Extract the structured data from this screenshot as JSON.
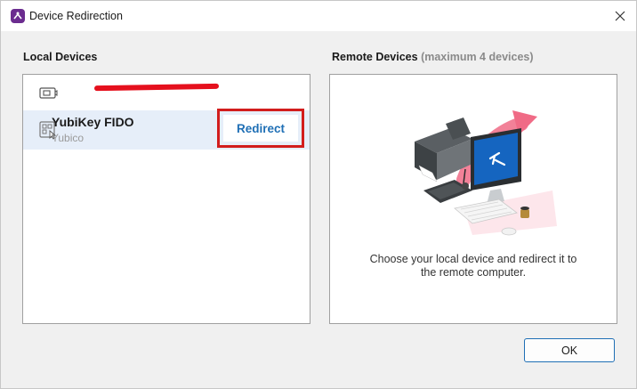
{
  "window": {
    "title": "Device Redirection",
    "close_symbol": "✕"
  },
  "local": {
    "heading": "Local Devices",
    "devices": [
      {
        "name": "",
        "vendor": "",
        "icon": "camera-icon",
        "redacted": true
      },
      {
        "name": "YubiKey FIDO",
        "vendor": "Yubico",
        "icon": "security-key-icon",
        "selected": true
      }
    ],
    "redirect_label": "Redirect"
  },
  "remote": {
    "heading": "Remote Devices",
    "heading_note": "(maximum 4 devices)",
    "empty_text_line1": "Choose your local device and redirect it to",
    "empty_text_line2": "the remote computer."
  },
  "footer": {
    "ok_label": "OK"
  },
  "colors": {
    "accent": "#1f6fb5",
    "highlight_box": "#d21d1d",
    "redaction": "#e5101d",
    "selected_row": "#e6eef9",
    "brand": "#6b2c8f"
  }
}
